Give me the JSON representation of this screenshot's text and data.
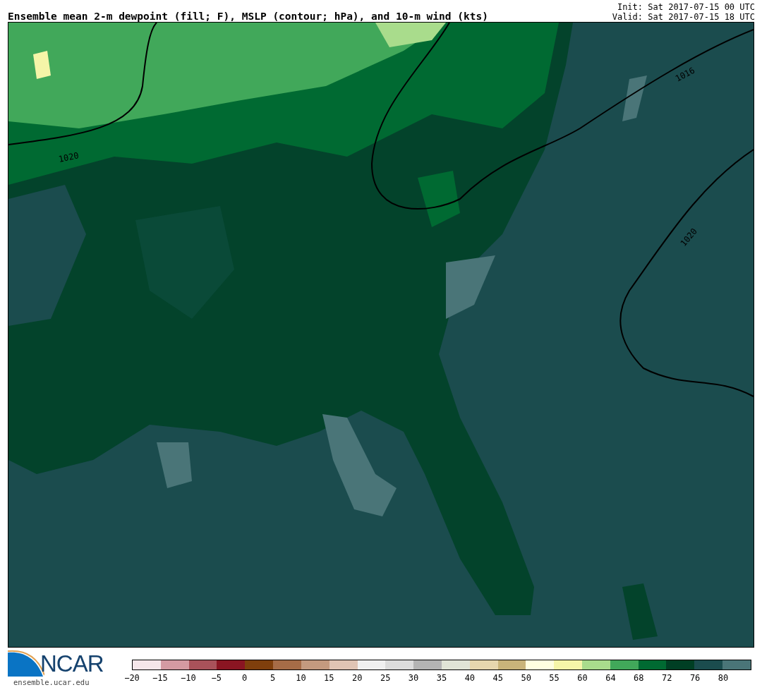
{
  "title": "Ensemble mean 2-m dewpoint (fill; F), MSLP (contour; hPa), and 10-m wind (kts)",
  "init": "Init: Sat 2017-07-15 00 UTC",
  "valid": "Valid: Sat 2017-07-15 18 UTC",
  "map": {
    "contour_labels": [
      "1020",
      "1016",
      "1020"
    ]
  },
  "logo": {
    "name": "NCAR",
    "url": "ensemble.ucar.edu"
  },
  "colorbar": {
    "swatches": [
      {
        "color": "#f5e6ea"
      },
      {
        "color": "#d49aa2"
      },
      {
        "color": "#a9525a"
      },
      {
        "color": "#8a1522"
      },
      {
        "color": "#7f3f0c"
      },
      {
        "color": "#a66c47"
      },
      {
        "color": "#c49a7f"
      },
      {
        "color": "#e0c4b4"
      },
      {
        "color": "#f0f0f0"
      },
      {
        "color": "#dcdcdc"
      },
      {
        "color": "#b4b4b4"
      },
      {
        "color": "#e0e4d6"
      },
      {
        "color": "#e6d6ae"
      },
      {
        "color": "#c9b47a"
      },
      {
        "color": "#fefee0"
      },
      {
        "color": "#f5f5a8"
      },
      {
        "color": "#a9dc8c"
      },
      {
        "color": "#41a85a"
      },
      {
        "color": "#006a32"
      },
      {
        "color": "#003f24"
      },
      {
        "color": "#1b4c4e"
      },
      {
        "color": "#4a7578"
      }
    ],
    "labels": [
      "−20",
      "−15",
      "−10",
      "−5",
      "0",
      "5",
      "10",
      "15",
      "20",
      "25",
      "30",
      "35",
      "40",
      "45",
      "50",
      "55",
      "60",
      "64",
      "68",
      "72",
      "76",
      "80"
    ]
  }
}
